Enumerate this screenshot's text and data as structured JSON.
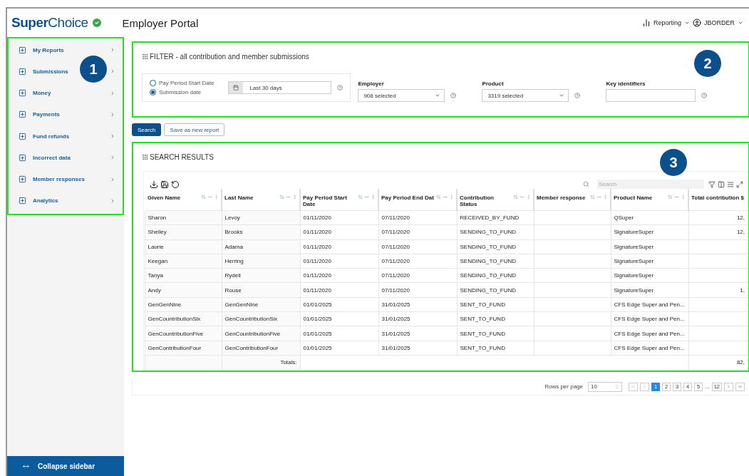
{
  "header": {
    "logo": {
      "bold": "Super",
      "light": "Choice"
    },
    "title": "Employer Portal",
    "reporting": "Reporting",
    "user": "JBORDER"
  },
  "sidebar": {
    "callout": "1",
    "items": [
      {
        "label": "My Reports"
      },
      {
        "label": "Submissions"
      },
      {
        "label": "Money"
      },
      {
        "label": "Payments"
      },
      {
        "label": "Fund refunds"
      },
      {
        "label": "Incorrect data"
      },
      {
        "label": "Member responses"
      },
      {
        "label": "Analytics"
      }
    ],
    "collapse": "Collapse sidebar"
  },
  "filter": {
    "callout": "2",
    "title": "FILTER - all contribution and member submissions",
    "date_types": [
      {
        "label": "Pay Period Start Date",
        "selected": false
      },
      {
        "label": "Submission date",
        "selected": true
      }
    ],
    "date_range": "Last 30 days",
    "dropdowns": [
      {
        "label": "Employer",
        "value": "908 selected"
      },
      {
        "label": "Product",
        "value": "3319 selected"
      }
    ],
    "key_identifiers": {
      "label": "Key identifiers"
    }
  },
  "actions": {
    "search": "Search",
    "save": "Save as new report"
  },
  "results": {
    "callout": "3",
    "title": "SEARCH RESULTS",
    "search_placeholder": "Search",
    "columns": [
      "Given Name",
      "Last Name",
      "Pay Period Start Date",
      "Pay Period End Dat",
      "Contribution Status",
      "Member response",
      "Product Name",
      "Total contribution $"
    ],
    "rows": [
      [
        "Sharon",
        "Levoy",
        "01/11/2020",
        "07/11/2020",
        "RECEIVED_BY_FUND",
        "",
        "QSuper",
        "12,"
      ],
      [
        "Shelley",
        "Brooks",
        "01/11/2020",
        "07/11/2020",
        "SENDING_TO_FUND",
        "",
        "SignatureSuper",
        "12,"
      ],
      [
        "Laurie",
        "Adama",
        "01/11/2020",
        "07/11/2020",
        "SENDING_TO_FUND",
        "",
        "SignatureSuper",
        ""
      ],
      [
        "Keegan",
        "Herring",
        "01/11/2020",
        "07/11/2020",
        "SENDING_TO_FUND",
        "",
        "SignatureSuper",
        ""
      ],
      [
        "Tanya",
        "Rydell",
        "01/11/2020",
        "07/11/2020",
        "SENDING_TO_FUND",
        "",
        "SignatureSuper",
        ""
      ],
      [
        "Andy",
        "Rouse",
        "01/11/2020",
        "07/11/2020",
        "SENDING_TO_FUND",
        "",
        "SignatureSuper",
        "1,"
      ],
      [
        "GenGenNine",
        "GenGenNine",
        "01/01/2025",
        "31/01/2025",
        "SENT_TO_FUND",
        "",
        "CFS Edge Super and Pen...",
        ""
      ],
      [
        "GenCountributionSix",
        "GenCountributionSix",
        "01/01/2025",
        "31/01/2025",
        "SENT_TO_FUND",
        "",
        "CFS Edge Super and Pen...",
        ""
      ],
      [
        "GenCountributionFive",
        "GenCountributionFive",
        "01/01/2025",
        "31/01/2025",
        "SENT_TO_FUND",
        "",
        "CFS Edge Super and Pen...",
        ""
      ],
      [
        "GenContributionFour",
        "GenContributionFour",
        "01/01/2025",
        "31/01/2025",
        "SENT_TO_FUND",
        "",
        "CFS Edge Super and Pen...",
        ""
      ]
    ],
    "totals_label": "Totals:",
    "totals_value": "82,",
    "pagination": {
      "rows_label": "Rows per page",
      "rows_value": "10",
      "pages": [
        {
          "label": "1",
          "selected": true
        },
        {
          "label": "2",
          "selected": false
        },
        {
          "label": "3",
          "selected": false
        },
        {
          "label": "4",
          "selected": false
        },
        {
          "label": "5",
          "selected": false
        }
      ],
      "ellipsis": "...",
      "last_page": "12"
    }
  }
}
